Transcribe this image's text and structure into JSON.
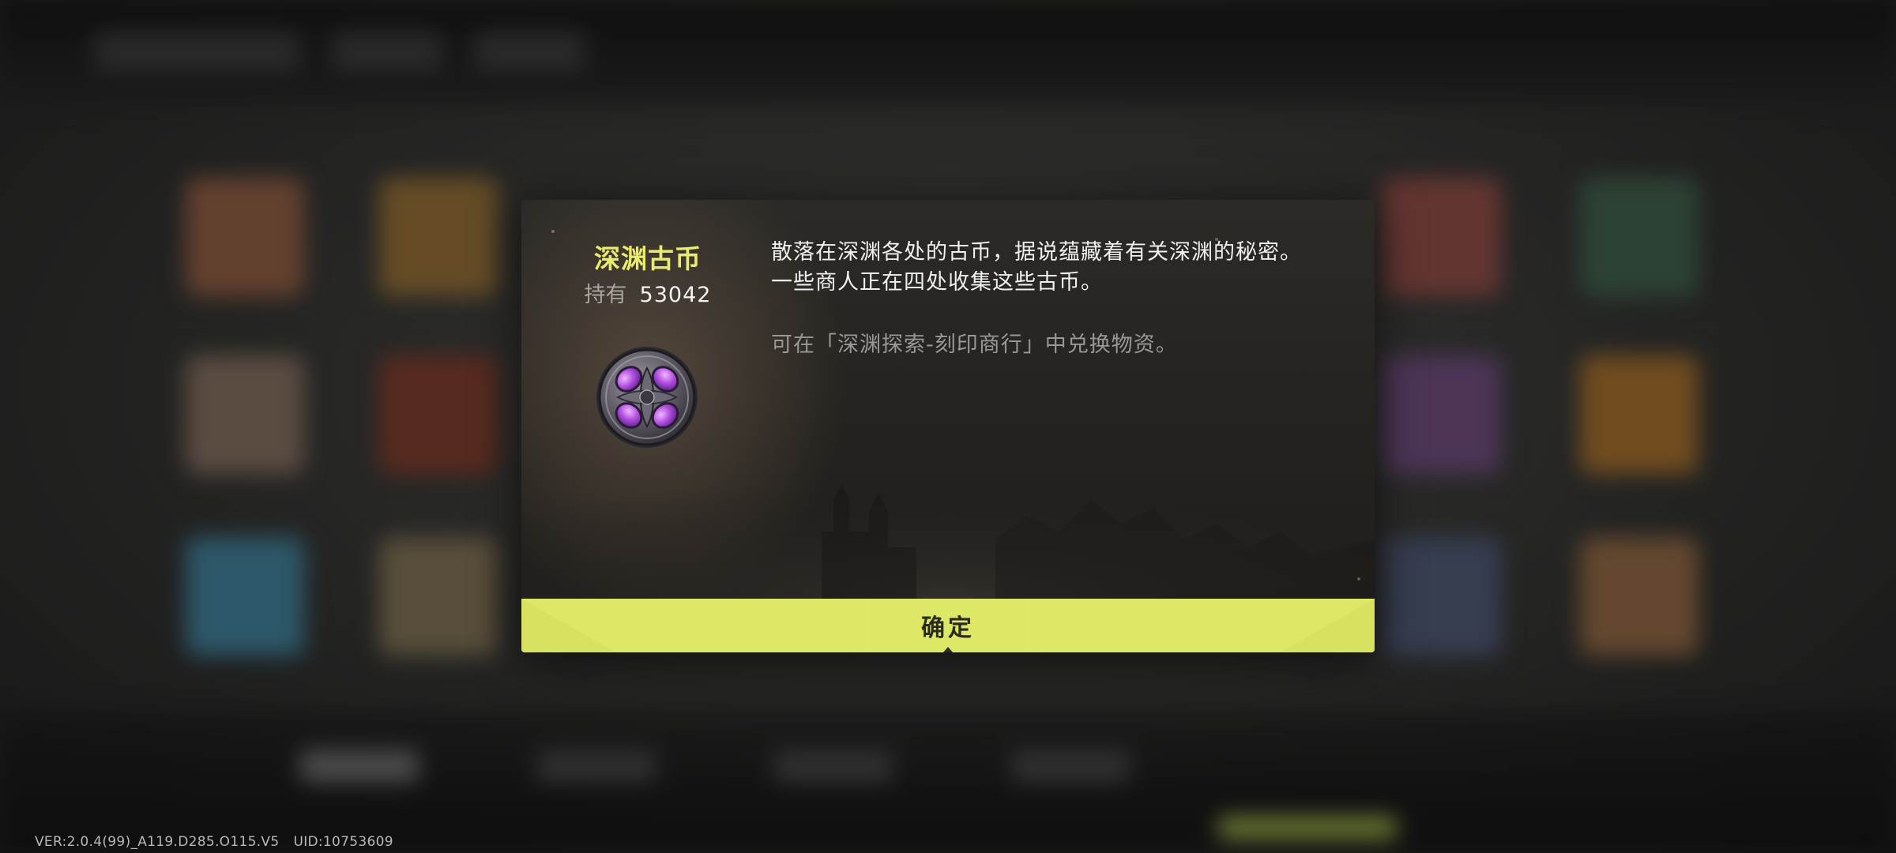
{
  "item": {
    "name": "深渊古币",
    "hold_label": "持有",
    "hold_count": "53042",
    "icon": "abyss-coin-icon"
  },
  "description": {
    "lines": [
      "散落在深渊各处的古币，据说蕴藏着有关深渊的秘密。",
      "一些商人正在四处收集这些古币。"
    ],
    "note": "可在「深渊探索-刻印商行」中兑换物资。"
  },
  "dialog": {
    "confirm_label": "确定"
  },
  "footer": {
    "version": "VER:2.0.4(99)_A119.D285.O115.V5",
    "uid": "UID:10753609"
  },
  "colors": {
    "title": "#e8ec6a",
    "confirm_button": "#dde866",
    "note_text": "#9a9894",
    "coin_gem": "#b14fe0"
  }
}
